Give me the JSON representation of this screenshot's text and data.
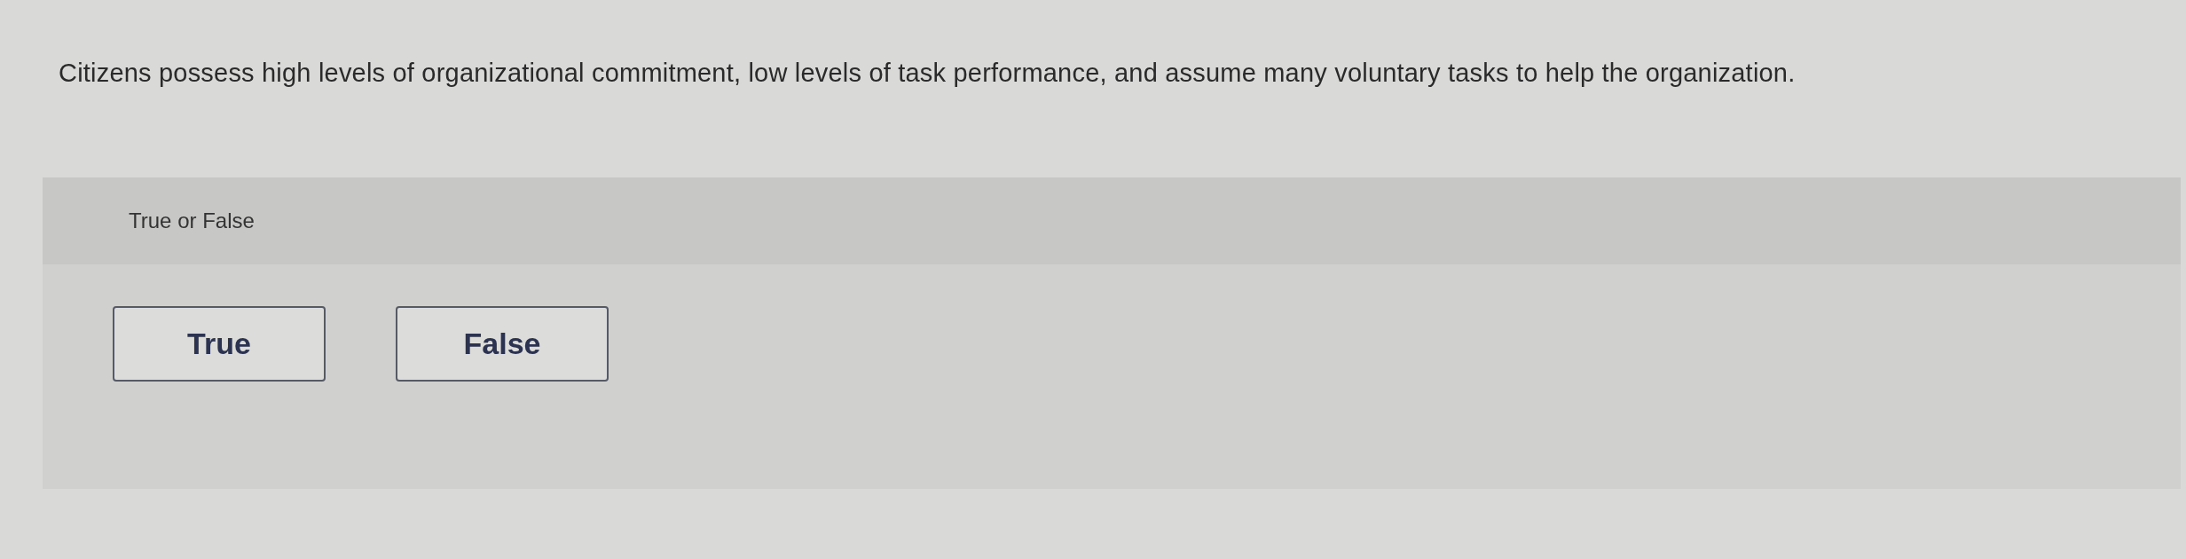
{
  "question": {
    "text": "Citizens possess high levels of organizational commitment, low levels of task performance, and assume many voluntary tasks to help the organization."
  },
  "prompt": {
    "label": "True or False"
  },
  "options": [
    {
      "label": "True",
      "selected": false
    },
    {
      "label": "False",
      "selected": false
    }
  ]
}
